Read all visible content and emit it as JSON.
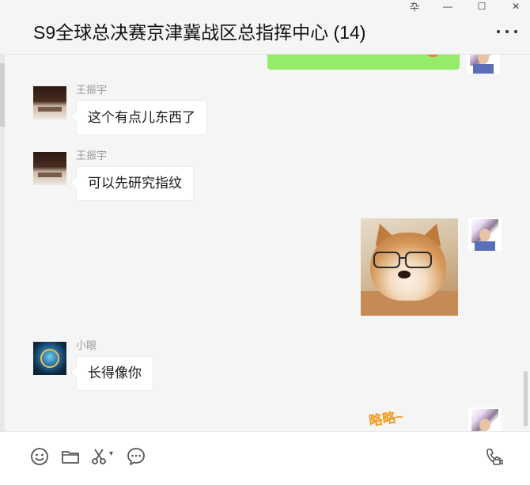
{
  "window": {
    "title": "S9全球总决赛京津冀战区总指挥中心 (14)",
    "controls": {
      "pin": "卆",
      "minimize": "—",
      "maximize": "☐",
      "close": "✕"
    }
  },
  "messages": [
    {
      "id": "m1",
      "side": "left",
      "sender": "王振宇",
      "avatar": "dark-stage-avatar",
      "text": "这个有点儿东西了"
    },
    {
      "id": "m2",
      "side": "left",
      "sender": "王振宇",
      "avatar": "dark-stage-avatar",
      "text": "可以先研究指纹"
    },
    {
      "id": "m3",
      "side": "right",
      "type": "image",
      "content": "shiba-dog-with-glasses",
      "avatar": "anime-character-avatar"
    },
    {
      "id": "m4",
      "side": "left",
      "sender": "小眼",
      "avatar": "game-badge-avatar",
      "text": "长得像你"
    },
    {
      "id": "m5",
      "side": "right",
      "type": "sticker",
      "text": "略略~",
      "avatar": "anime-character-avatar"
    }
  ],
  "toolbar": {
    "icons": [
      "emoji-icon",
      "folder-icon",
      "scissors-icon",
      "chat-history-icon",
      "voice-video-call-icon"
    ]
  },
  "colors": {
    "my_bubble": "#95ec69",
    "bubble": "#ffffff",
    "background": "#f5f5f5",
    "sticker_text": "#f29c1f"
  }
}
